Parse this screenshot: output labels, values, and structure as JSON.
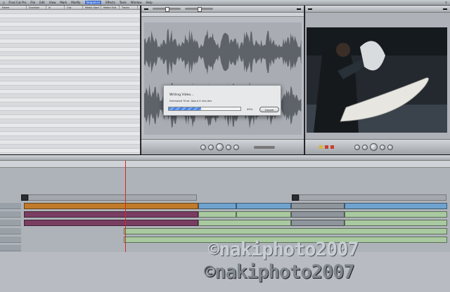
{
  "menubar": {
    "items": [
      "Final Cut Pro",
      "File",
      "Edit",
      "View",
      "Mark",
      "Modify",
      "Sequence",
      "Effects",
      "Tools",
      "Window",
      "Help"
    ],
    "active_index": 6,
    "right": [
      "",
      "",
      "",
      ""
    ]
  },
  "browser": {
    "columns": [
      "Name",
      "Duration",
      "In",
      "Out",
      "Media Start",
      "Media End",
      "Tracks"
    ],
    "rows": [
      [
        "",
        "",
        "",
        "",
        "",
        "",
        ""
      ],
      [
        "",
        "",
        "",
        "",
        "",
        "",
        ""
      ],
      [
        "",
        "",
        "",
        "",
        "",
        "",
        ""
      ],
      [
        "",
        "",
        "",
        "",
        "",
        "",
        ""
      ],
      [
        "",
        "",
        "",
        "",
        "",
        "",
        ""
      ],
      [
        "",
        "",
        "",
        "",
        "",
        "",
        ""
      ],
      [
        "",
        "",
        "",
        "",
        "",
        "",
        ""
      ],
      [
        "",
        "",
        "",
        "",
        "",
        "",
        ""
      ],
      [
        "",
        "",
        "",
        "",
        "",
        "",
        ""
      ],
      [
        "",
        "",
        "",
        "",
        "",
        "",
        ""
      ],
      [
        "",
        "",
        "",
        "",
        "",
        "",
        ""
      ],
      [
        "",
        "",
        "",
        "",
        "",
        "",
        ""
      ],
      [
        "",
        "",
        "",
        "",
        "",
        "",
        ""
      ],
      [
        "",
        "",
        "",
        "",
        "",
        "",
        ""
      ],
      [
        "",
        "",
        "",
        "",
        "",
        "",
        ""
      ],
      [
        "",
        "",
        "",
        "",
        "",
        "",
        ""
      ],
      [
        "",
        "",
        "",
        "",
        "",
        "",
        ""
      ],
      [
        "",
        "",
        "",
        "",
        "",
        "",
        ""
      ],
      [
        "",
        "",
        "",
        "",
        "",
        "",
        ""
      ],
      [
        "",
        "",
        "",
        "",
        "",
        "",
        ""
      ],
      [
        "",
        "",
        "",
        "",
        "",
        "",
        ""
      ],
      [
        "",
        "",
        "",
        "",
        "",
        "",
        ""
      ],
      [
        "",
        "",
        "",
        "",
        "",
        "",
        ""
      ],
      [
        "",
        "",
        "",
        "",
        "",
        "",
        ""
      ],
      [
        "",
        "",
        "",
        "",
        "",
        "",
        ""
      ],
      [
        "",
        "",
        "",
        "",
        "",
        "",
        ""
      ],
      [
        "",
        "",
        "",
        "",
        "",
        "",
        ""
      ],
      [
        "",
        "",
        "",
        "",
        "",
        "",
        ""
      ],
      [
        "",
        "",
        "",
        "",
        "",
        "",
        ""
      ],
      [
        "",
        "",
        "",
        "",
        "",
        "",
        ""
      ],
      [
        "",
        "",
        "",
        "",
        "",
        "",
        ""
      ],
      [
        "",
        "",
        "",
        "",
        "",
        "",
        ""
      ],
      [
        "",
        "",
        "",
        "",
        "",
        "",
        ""
      ],
      [
        "",
        "",
        "",
        "",
        "",
        "",
        ""
      ]
    ]
  },
  "viewer": {
    "timecode_left": "",
    "timecode_right": "",
    "ruler": [
      "",
      "",
      "",
      ""
    ]
  },
  "canvas": {
    "timecode_left": "",
    "timecode_right": ""
  },
  "dialog": {
    "title": "Writing Video...",
    "subtitle": "Estimated Time: About 4 minutes",
    "progress_percent": 45,
    "progress_label": "45%",
    "cancel_label": "Cancel"
  },
  "timeline": {
    "tabs": [
      "",
      ""
    ],
    "ruler": [
      "",
      "",
      "",
      "",
      "",
      "",
      "",
      "",
      "",
      "",
      ""
    ],
    "clips": {
      "v2_top": "",
      "v1_a": "",
      "v1_b": "",
      "v1_c": "",
      "v1_d": "",
      "a1_a": "",
      "a1_b": "",
      "a1_c": "",
      "a1_d": "",
      "a2_a": "",
      "a2_b": "",
      "a2_c": "",
      "a3_a": "",
      "a3_b": ""
    }
  },
  "watermark": {
    "line1": "©nakiphoto2007",
    "line2": "©nakiphoto2007"
  },
  "colors": {
    "video_clip": "#c07a2a",
    "audio_clip": "#7a3d62",
    "progress": "#4a84e0",
    "playhead": "#d52a1f"
  }
}
